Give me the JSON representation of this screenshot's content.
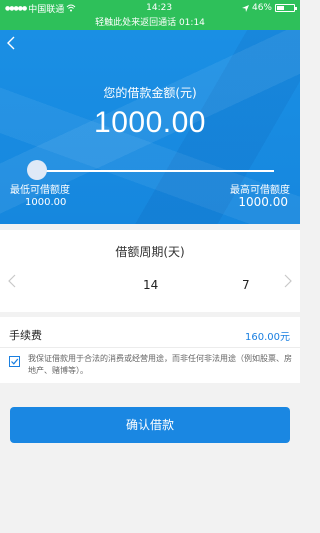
{
  "status_bar": {
    "carrier": "中国联通",
    "time": "14:23",
    "battery": "46%",
    "battery_level": 0.46
  },
  "call_banner": "轻触此处来返回通话 01:14",
  "loan": {
    "amount_label": "您的借款金额(元)",
    "amount_value": "1000.00",
    "slider_level": 0.0,
    "min_label": "最低可借额度",
    "min_value": "1000.00",
    "max_label": "最高可借额度",
    "max_value": "1000.00"
  },
  "period": {
    "title": "借额周期(天)",
    "options": [
      "14",
      "7"
    ]
  },
  "fee": {
    "label": "手续费",
    "value": "160.00元"
  },
  "agreement": {
    "checked": true,
    "text": "我保证借款用于合法的消费或经营用途，而非任何非法用途（例如股票、房地产、赌博等）。"
  },
  "confirm_label": "确认借款",
  "colors": {
    "status_green": "#2ec05a",
    "hero_blue": "#1a8fe4",
    "accent_blue": "#1a87e2"
  },
  "icons": {
    "back": "chevron-left-icon",
    "prev": "chevron-left-icon",
    "next": "chevron-right-icon",
    "wifi": "wifi-icon",
    "check": "checkbox-icon"
  }
}
